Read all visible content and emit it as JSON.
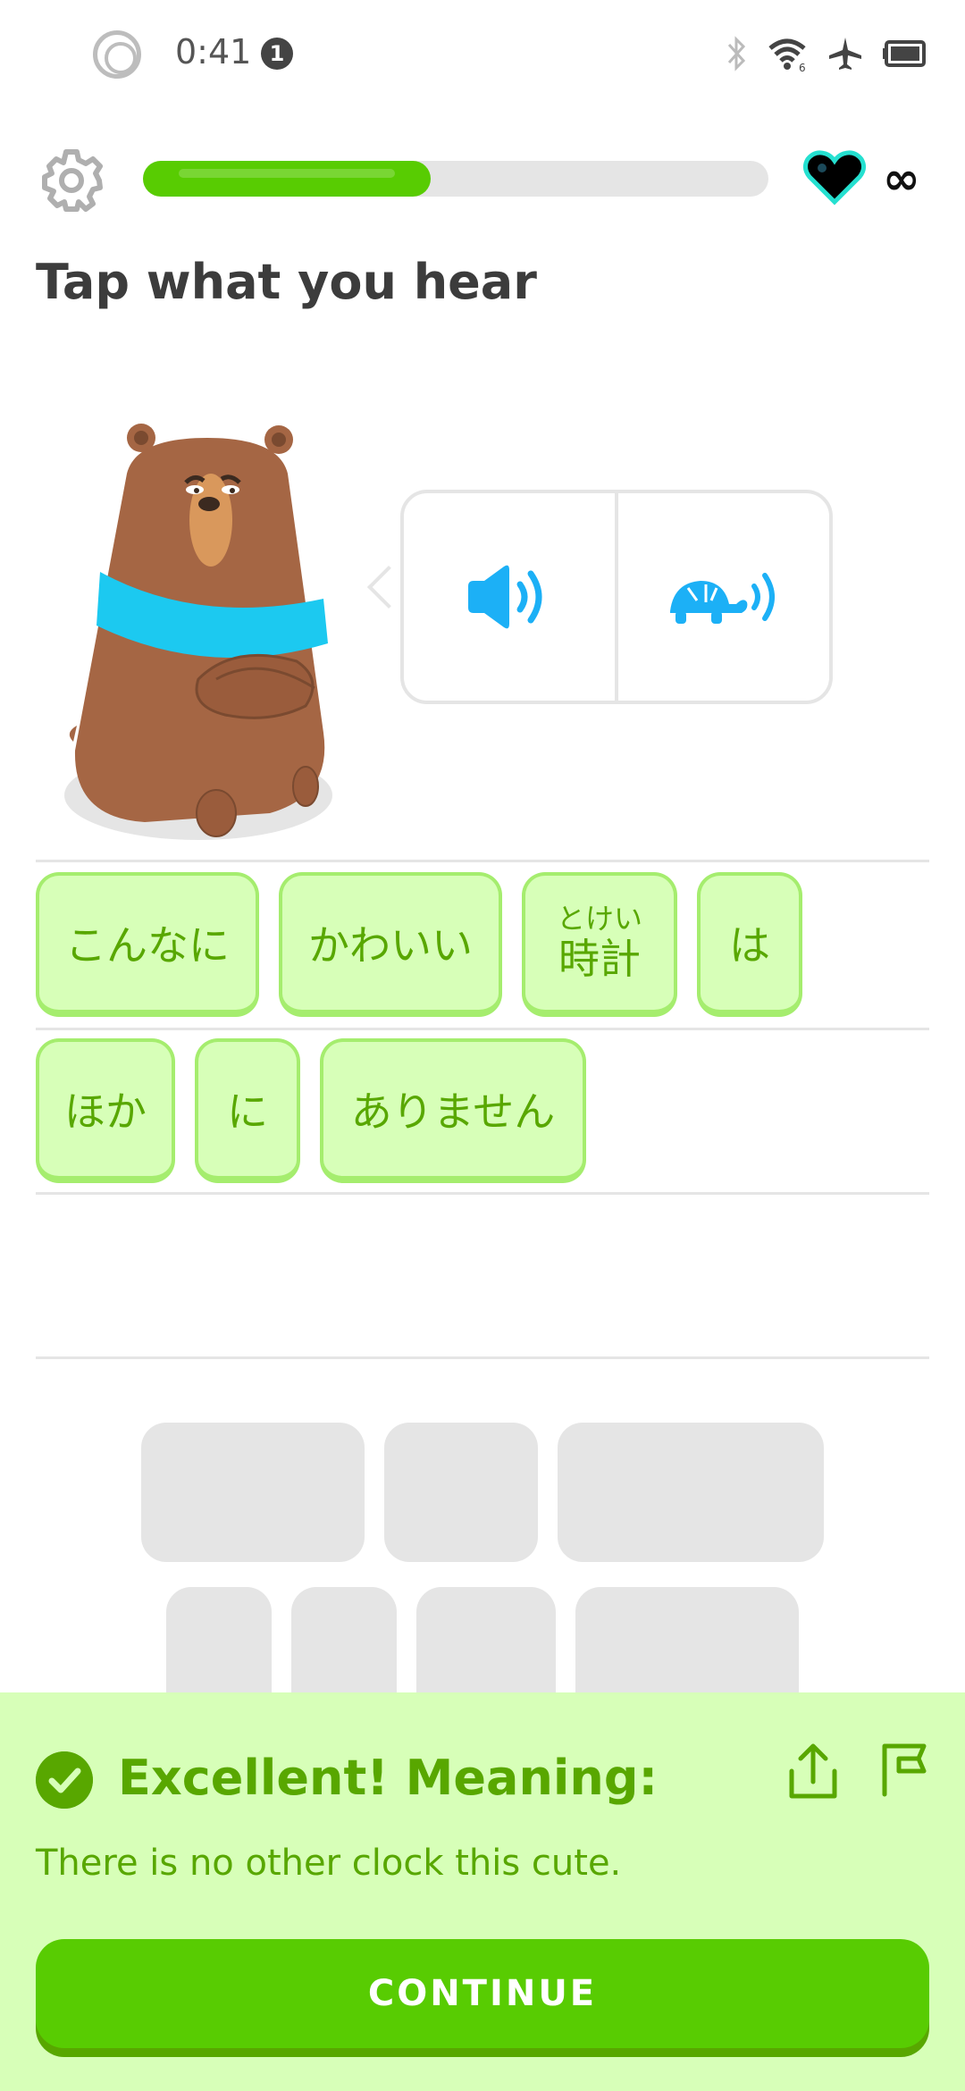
{
  "status_bar": {
    "time": "0:41",
    "notification_count": "1",
    "icons": [
      "record-icon",
      "bluetooth-icon",
      "wifi-icon",
      "airplane-icon",
      "battery-icon"
    ]
  },
  "header": {
    "settings_icon": "gear-icon",
    "progress": 0.46,
    "hearts_icon": "heart-icon",
    "hearts_value": "∞"
  },
  "exercise": {
    "title": "Tap what you hear",
    "character": "bear",
    "audio_buttons": [
      {
        "icon": "speaker-icon",
        "label": "normal speed audio"
      },
      {
        "icon": "turtle-speaker-icon",
        "label": "slow audio"
      }
    ]
  },
  "answer": {
    "row1": [
      {
        "text": "こんなに"
      },
      {
        "text": "かわいい"
      },
      {
        "furigana": "とけい",
        "text": "時計"
      },
      {
        "text": "は"
      }
    ],
    "row2": [
      {
        "text": "ほか"
      },
      {
        "text": "に"
      },
      {
        "text": "ありません"
      }
    ]
  },
  "feedback": {
    "title": "Excellent! Meaning:",
    "meaning": "There is no other clock this cute.",
    "continue_label": "CONTINUE"
  },
  "colors": {
    "primary_green": "#58cc02",
    "dark_green": "#58a700",
    "light_green_bg": "#d7ffb8",
    "chip_border": "#a5ed6e",
    "audio_blue": "#1cb0f6",
    "gray_line": "#e5e5e5"
  }
}
